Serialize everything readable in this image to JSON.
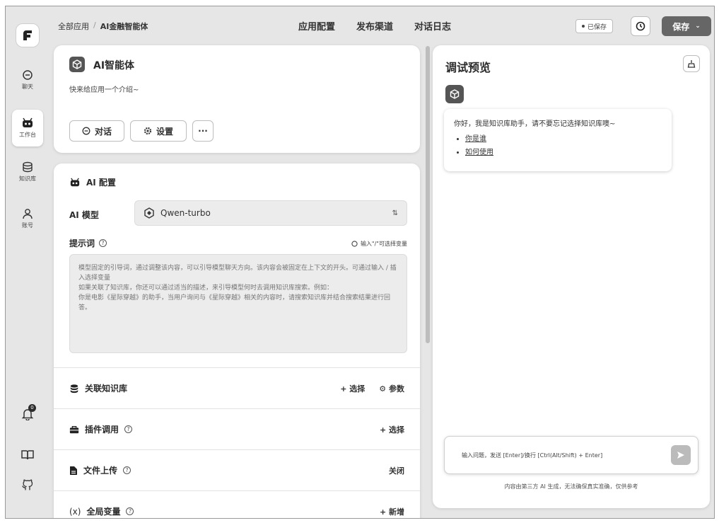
{
  "rail": {
    "items": [
      {
        "label": "聊天",
        "icon": "chat-icon"
      },
      {
        "label": "工作台",
        "icon": "robot-icon"
      },
      {
        "label": "知识库",
        "icon": "database-icon"
      },
      {
        "label": "账号",
        "icon": "user-icon"
      }
    ],
    "notification_count": "0",
    "bottom_icons": [
      "bell-icon",
      "book-icon",
      "github-icon"
    ]
  },
  "header": {
    "breadcrumb": [
      "全部应用",
      "AI金融智能体"
    ],
    "breadcrumb_sep": "/",
    "tabs": [
      "应用配置",
      "发布渠道",
      "对话日志"
    ],
    "saved_label": "已保存",
    "save_button": "保存"
  },
  "app": {
    "name": "AI智能体",
    "description": "快来给应用一个介绍~",
    "buttons": {
      "chat": "对话",
      "settings": "设置",
      "more": "···"
    }
  },
  "ai_config": {
    "title": "AI 配置",
    "model_label": "AI 模型",
    "model_value": "Qwen-turbo",
    "prompt_label": "提示词",
    "var_hint": "输入\"/\"可选择变量",
    "prompt_placeholder": "模型固定的引导词，通过调整该内容，可以引导模型聊天方向。该内容会被固定在上下文的开头。可通过输入 / 插入选择变量\n如果关联了知识库，你还可以通过适当的描述，来引导模型何时去调用知识库搜索。例如：\n你是电影《星际穿越》的助手，当用户询问与《星际穿越》相关的内容时，请搜索知识库并结合搜索结果进行回答。"
  },
  "rows": [
    {
      "title": "关联知识库",
      "icon": "database-icon",
      "help": false,
      "actions": [
        "+ 选择",
        "⚙ 参数"
      ]
    },
    {
      "title": "插件调用",
      "icon": "toolbox-icon",
      "help": true,
      "actions": [
        "+ 选择"
      ]
    },
    {
      "title": "文件上传",
      "icon": "file-icon",
      "help": true,
      "actions": [
        "关闭"
      ]
    },
    {
      "title": "全局变量",
      "icon": "variable-icon",
      "help": true,
      "actions": [
        "+ 新增"
      ]
    }
  ],
  "preview": {
    "title": "调试预览",
    "greeting": "你好，我是知识库助手，请不要忘记选择知识库噢~",
    "links": [
      "你是谁",
      "如何使用"
    ],
    "input_placeholder": "输入问题，发送 [Enter]/换行 [Ctrl(Alt/Shift) + Enter]",
    "disclaimer": "内容由第三方 AI 生成，无法确保真实准确，仅供参考"
  }
}
